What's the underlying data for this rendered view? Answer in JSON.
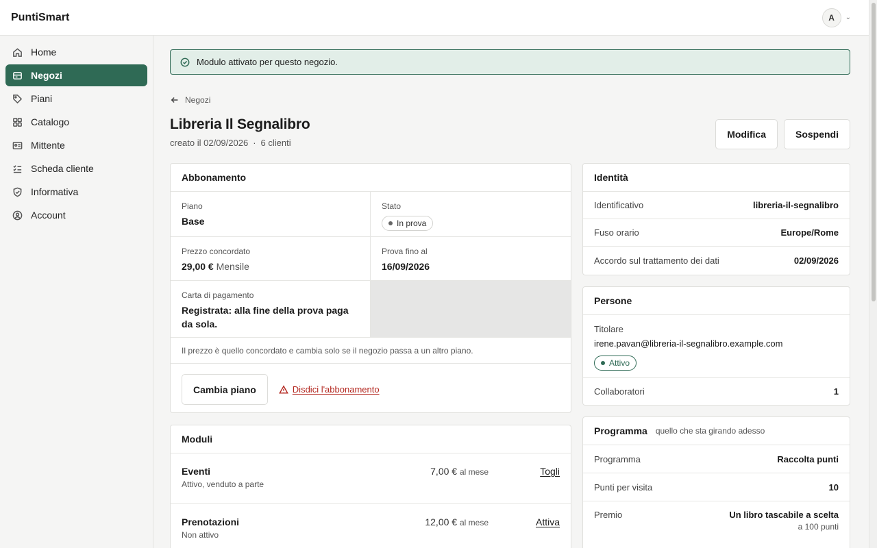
{
  "app": {
    "brand": "PuntiSmart",
    "user_initial": "A"
  },
  "sidebar": {
    "items": [
      {
        "label": "Home",
        "icon": "home-icon"
      },
      {
        "label": "Negozi",
        "icon": "store-icon",
        "active": true
      },
      {
        "label": "Piani",
        "icon": "tag-icon"
      },
      {
        "label": "Catalogo",
        "icon": "grid-icon"
      },
      {
        "label": "Mittente",
        "icon": "id-card-icon"
      },
      {
        "label": "Scheda cliente",
        "icon": "checklist-icon"
      },
      {
        "label": "Informativa",
        "icon": "shield-icon"
      },
      {
        "label": "Account",
        "icon": "user-circle-icon"
      }
    ]
  },
  "alert": {
    "text": "Modulo attivato per questo negozio."
  },
  "page": {
    "back_label": "Negozi",
    "title": "Libreria Il Segnalibro",
    "created": "creato il 02/09/2026",
    "clients": "6 clienti",
    "edit_label": "Modifica",
    "suspend_label": "Sospendi"
  },
  "subscription": {
    "title": "Abbonamento",
    "plan_label": "Piano",
    "plan_value": "Base",
    "status_label": "Stato",
    "status_value": "In prova",
    "price_label": "Prezzo concordato",
    "price_value": "29,00 €",
    "price_period": "Mensile",
    "trial_label": "Prova fino al",
    "trial_value": "16/09/2026",
    "card_label": "Carta di pagamento",
    "card_value": "Registrata: alla fine della prova paga da sola.",
    "note": "Il prezzo è quello concordato e cambia solo se il negozio passa a un altro piano.",
    "change_plan_label": "Cambia piano",
    "cancel_label": "Disdici l'abbonamento"
  },
  "modules": {
    "title": "Moduli",
    "items": [
      {
        "name": "Eventi",
        "desc": "Attivo, venduto a parte",
        "price": "7,00 €",
        "unit": "al mese",
        "action": "Togli"
      },
      {
        "name": "Prenotazioni",
        "desc": "Non attivo",
        "price": "12,00 €",
        "unit": "al mese",
        "action": "Attiva"
      }
    ]
  },
  "identity": {
    "title": "Identità",
    "rows": [
      {
        "k": "Identificativo",
        "v": "libreria-il-segnalibro"
      },
      {
        "k": "Fuso orario",
        "v": "Europe/Rome"
      },
      {
        "k": "Accordo sul trattamento dei dati",
        "v": "02/09/2026"
      }
    ]
  },
  "people": {
    "title": "Persone",
    "owner_label": "Titolare",
    "owner_email": "irene.pavan@libreria-il-segnalibro.example.com",
    "owner_status": "Attivo",
    "collab_label": "Collaboratori",
    "collab_value": "1"
  },
  "program": {
    "title": "Programma",
    "subtitle": "quello che sta girando adesso",
    "rows": [
      {
        "k": "Programma",
        "v": "Raccolta punti"
      },
      {
        "k": "Punti per visita",
        "v": "10"
      }
    ],
    "reward_label": "Premio",
    "reward_value": "Un libro tascabile a scelta",
    "reward_sub": "a 100 punti"
  },
  "colors": {
    "accent": "#2f6a55",
    "danger": "#b3261e",
    "alert_bg": "#e2eee8"
  }
}
